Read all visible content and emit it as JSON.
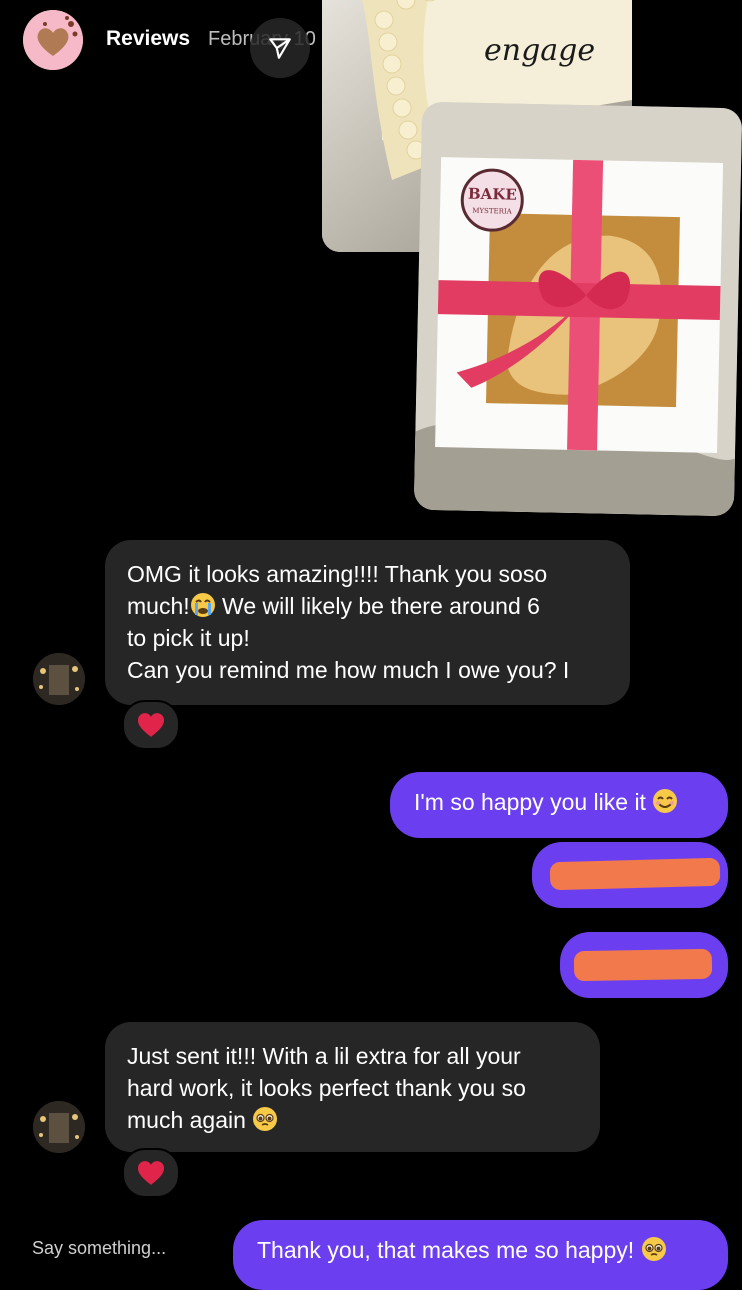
{
  "header": {
    "title": "Reviews",
    "date": "February 10"
  },
  "photos": {
    "back_text": "engage",
    "box_logo_line1": "BAKE",
    "box_logo_line2": "MYSTERIA"
  },
  "messages": {
    "incoming_1": {
      "line1": "OMG it looks amazing!!!! Thank you soso",
      "line2a": "much!",
      "line2b": " We will likely be there around 6",
      "line3": "to pick it up!",
      "line4": "Can you remind me how much I owe you? I"
    },
    "outgoing_1": {
      "text": "I'm so happy you like it "
    },
    "incoming_2": {
      "line1": "Just sent it!!! With a lil extra for all your",
      "line2": "hard work, it looks perfect thank you so",
      "line3": "much again "
    },
    "outgoing_last": {
      "text": "Thank you, that makes me so happy! "
    }
  },
  "composer": {
    "placeholder": "Say something..."
  },
  "colors": {
    "incoming_bubble": "#262626",
    "outgoing_bubble": "#6b3ff0",
    "redaction": "#f2794c",
    "heart": "#e0244a"
  },
  "icons": [
    "share-icon",
    "heart-reaction-icon",
    "crying-emoji-icon",
    "smiling-emoji-icon",
    "pleading-emoji-icon"
  ]
}
